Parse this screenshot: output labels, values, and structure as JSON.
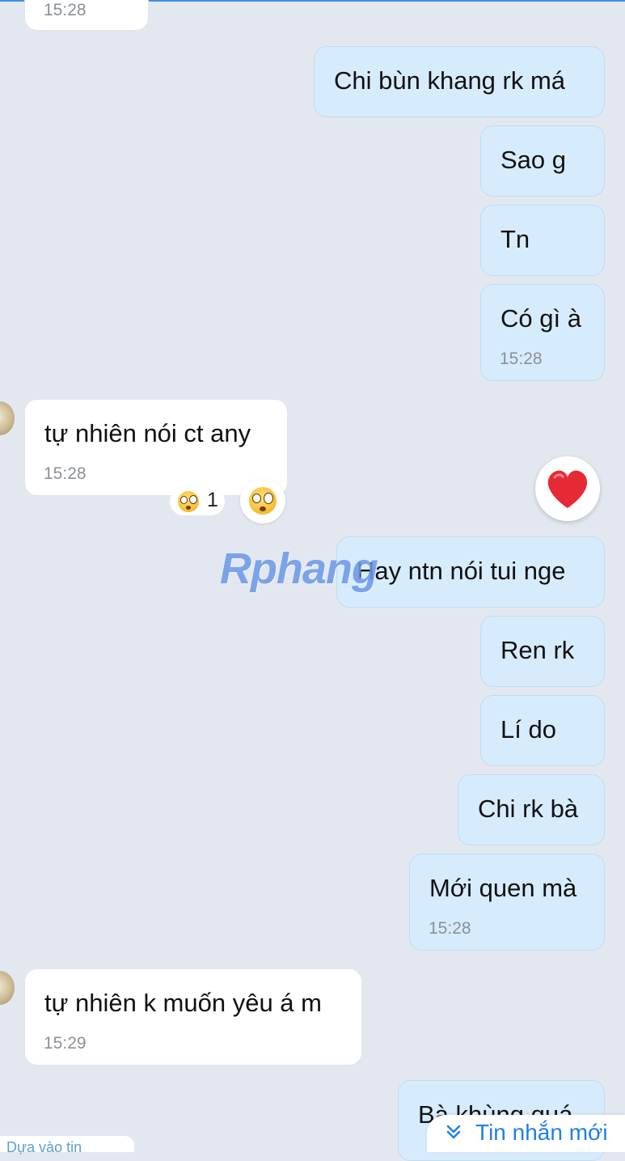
{
  "messages": [
    {
      "id": "m0",
      "direction": "in",
      "text": "",
      "time": "15:28"
    },
    {
      "id": "m1",
      "direction": "out",
      "text": "Chi bùn khang rk má",
      "time": ""
    },
    {
      "id": "m2",
      "direction": "out",
      "text": "Sao g",
      "time": ""
    },
    {
      "id": "m3",
      "direction": "out",
      "text": "Tn",
      "time": ""
    },
    {
      "id": "m4",
      "direction": "out",
      "text": "Có gì à",
      "time": "15:28"
    },
    {
      "id": "m5",
      "direction": "in",
      "text": "tự nhiên nói ct any",
      "time": "15:28"
    },
    {
      "id": "m6",
      "direction": "out",
      "text": "Hay ntn nói tui nge",
      "time": ""
    },
    {
      "id": "m7",
      "direction": "out",
      "text": "Ren rk",
      "time": ""
    },
    {
      "id": "m8",
      "direction": "out",
      "text": "Lí do",
      "time": ""
    },
    {
      "id": "m9",
      "direction": "out",
      "text": "Chi rk bà",
      "time": ""
    },
    {
      "id": "m10",
      "direction": "out",
      "text": "Mới quen mà",
      "time": "15:28"
    },
    {
      "id": "m11",
      "direction": "in",
      "text": "tự nhiên k muốn yêu á m",
      "time": "15:29"
    },
    {
      "id": "m12",
      "direction": "out",
      "text": "Bà khùng quá",
      "time": ""
    }
  ],
  "reaction": {
    "emoji": "flushed-face",
    "count": "1"
  },
  "quick_reaction": {
    "emoji": "red-heart"
  },
  "new_messages_button": {
    "label": "Tin nhắn mới"
  },
  "bottom_left_hint": {
    "label": "Dựa vào tin"
  },
  "watermark": "Rphang",
  "colors": {
    "outgoing_bubble": "#d6ecfc",
    "incoming_bubble": "#ffffff",
    "background": "#e3e8f0",
    "accent": "#1f7fe6"
  }
}
